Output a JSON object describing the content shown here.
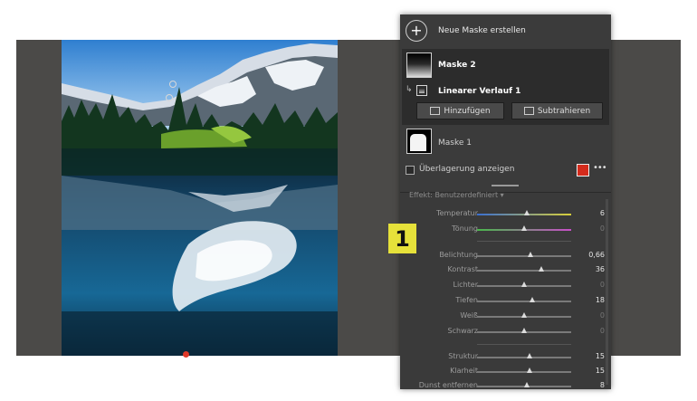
{
  "mask_panel": {
    "new_mask_label": "Neue Maske erstellen",
    "masks": [
      {
        "name": "Maske 2",
        "selected": true,
        "components": [
          {
            "name": "Linearer Verlauf 1"
          }
        ]
      },
      {
        "name": "Maske 1",
        "selected": false
      }
    ],
    "add_label": "Hinzufügen",
    "subtract_label": "Subtrahieren",
    "overlay_label": "Überlagerung anzeigen",
    "overlay_color": "#d42b1c",
    "more_label": "•••"
  },
  "adjust_panel": {
    "cutoff_text": "Effekt:            Benutzerdefiniert ▾",
    "sliders": [
      {
        "label": "Temperatur",
        "value": "6",
        "fraction": 0.53,
        "track": "temp"
      },
      {
        "label": "Tönung",
        "value": "0",
        "fraction": 0.5,
        "track": "tint"
      },
      {
        "label": "Belichtung",
        "value": "0,66",
        "fraction": 0.57
      },
      {
        "label": "Kontrast",
        "value": "36",
        "fraction": 0.68
      },
      {
        "label": "Lichter",
        "value": "0",
        "fraction": 0.5
      },
      {
        "label": "Tiefen",
        "value": "18",
        "fraction": 0.59
      },
      {
        "label": "Weiß",
        "value": "0",
        "fraction": 0.5
      },
      {
        "label": "Schwarz",
        "value": "0",
        "fraction": 0.5
      },
      {
        "label": "Struktur",
        "value": "15",
        "fraction": 0.56
      },
      {
        "label": "Klarheit",
        "value": "15",
        "fraction": 0.56
      },
      {
        "label": "Dunst entfernen",
        "value": "8",
        "fraction": 0.53
      }
    ]
  },
  "annotation": {
    "badge_number": "1",
    "badge_color": "#e6e13a"
  }
}
